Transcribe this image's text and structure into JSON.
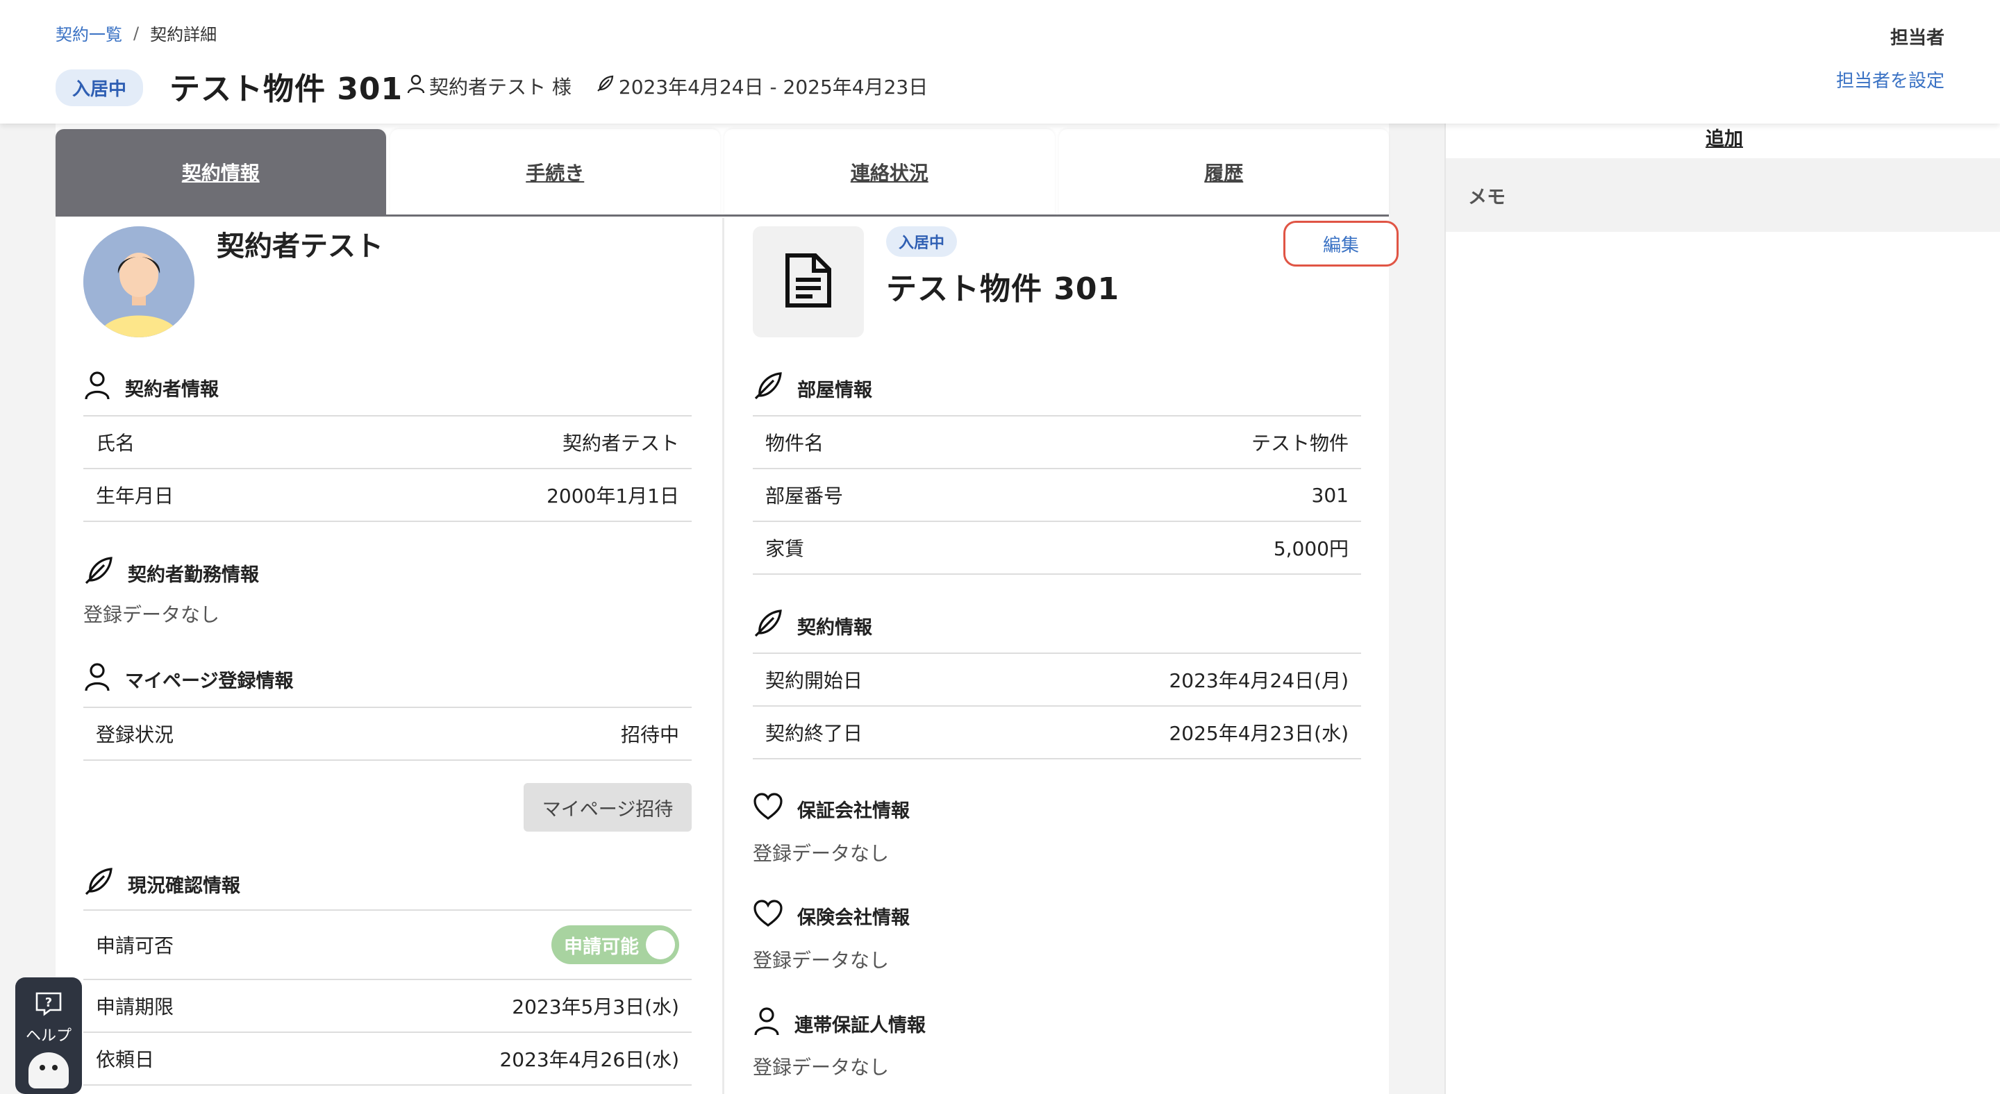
{
  "breadcrumb": {
    "items": [
      "契約一覧",
      "契約詳細"
    ],
    "separator": "/"
  },
  "header": {
    "status_badge": "入居中",
    "title": "テスト物件 301",
    "contractor": "契約者テスト 様",
    "period": "2023年4月24日 - 2025年4月23日",
    "staff_label": "担当者",
    "staff_link": "担当者を設定"
  },
  "tabs": [
    {
      "label": "契約情報",
      "active": true
    },
    {
      "label": "手続き",
      "active": false
    },
    {
      "label": "連絡状況",
      "active": false
    },
    {
      "label": "履歴",
      "active": false
    }
  ],
  "left": {
    "name": "契約者テスト",
    "contractor_info": {
      "title": "契約者情報",
      "rows": [
        {
          "label": "氏名",
          "value": "契約者テスト"
        },
        {
          "label": "生年月日",
          "value": "2000年1月1日"
        }
      ]
    },
    "work_info": {
      "title": "契約者勤務情報",
      "empty": "登録データなし"
    },
    "mypage_info": {
      "title": "マイページ登録情報",
      "rows": [
        {
          "label": "登録状況",
          "value": "招待中"
        }
      ],
      "invite_button": "マイページ招待"
    },
    "status_check": {
      "title": "現況確認情報",
      "apply_label": "申請可否",
      "toggle_label": "申請可能",
      "toggle_on": true,
      "rows": [
        {
          "label": "申請期限",
          "value": "2023年5月3日(水)"
        },
        {
          "label": "依頼日",
          "value": "2023年4月26日(水)"
        }
      ]
    }
  },
  "right": {
    "status_badge": "入居中",
    "title": "テスト物件 301",
    "edit_button": "編集",
    "room_info": {
      "title": "部屋情報",
      "rows": [
        {
          "label": "物件名",
          "value": "テスト物件"
        },
        {
          "label": "部屋番号",
          "value": "301"
        },
        {
          "label": "家賃",
          "value": "5,000円"
        }
      ]
    },
    "contract_info": {
      "title": "契約情報",
      "rows": [
        {
          "label": "契約開始日",
          "value": "2023年4月24日(月)"
        },
        {
          "label": "契約終了日",
          "value": "2025年4月23日(水)"
        }
      ]
    },
    "guarantor_company": {
      "title": "保証会社情報",
      "empty": "登録データなし"
    },
    "insurance_company": {
      "title": "保険会社情報",
      "empty": "登録データなし"
    },
    "joint_guarantor": {
      "title": "連帯保証人情報",
      "empty": "登録データなし"
    }
  },
  "side": {
    "add_link": "追加",
    "memo_label": "メモ"
  },
  "help": {
    "label": "ヘルプ"
  },
  "colors": {
    "accent": "#3a72c4",
    "badge_bg": "#e3ecf8",
    "tab_active": "#6e6e74",
    "toggle_on": "#a8d3a0",
    "edit_border": "#e05545"
  }
}
